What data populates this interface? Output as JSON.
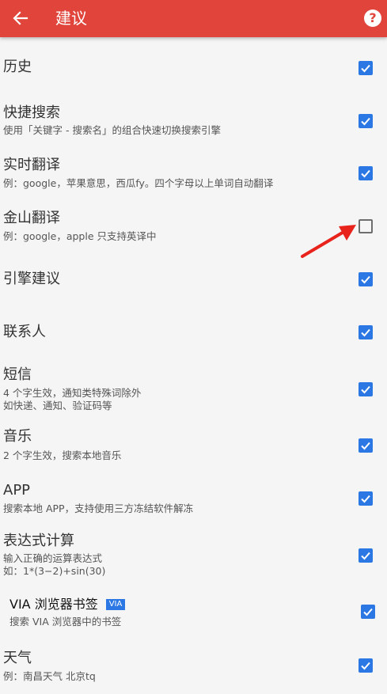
{
  "header": {
    "title": "建议",
    "help_glyph": "?"
  },
  "colors": {
    "appbar": "#e0443a",
    "checkbox_on": "#2b78e4",
    "arrow": "#e8231c"
  },
  "items": [
    {
      "title": "历史",
      "subtitle": "",
      "checked": true
    },
    {
      "title": "快捷搜索",
      "subtitle": "使用「关键字 - 搜索名」的组合快速切换搜索引擎",
      "checked": true
    },
    {
      "title": "实时翻译",
      "subtitle": "例：google，苹果意思，西瓜fy。四个字母以上单词自动翻译",
      "checked": true
    },
    {
      "title": "金山翻译",
      "subtitle": "例：google，apple 只支持英译中",
      "checked": false
    },
    {
      "title": "引擎建议",
      "subtitle": "",
      "checked": true
    },
    {
      "title": "联系人",
      "subtitle": "",
      "checked": true
    },
    {
      "title": "短信",
      "subtitle": "4 个字生效，通知类特殊词除外\n如快递、通知、验证码等",
      "checked": true
    },
    {
      "title": "音乐",
      "subtitle": "2 个字生效，搜索本地音乐",
      "checked": true
    },
    {
      "title": "APP",
      "subtitle": "搜索本地 APP，支持使用三方冻结软件解冻",
      "checked": true
    },
    {
      "title": "表达式计算",
      "subtitle": "输入正确的运算表达式\n如：1*(3−2)+sin(30)",
      "checked": true
    },
    {
      "title": "VIA 浏览器书签",
      "badge": "VIA",
      "subtitle": "搜索 VIA 浏览器中的书签",
      "checked": true
    },
    {
      "title": "天气",
      "subtitle": "例：南昌天气 北京tq",
      "checked": true
    }
  ]
}
